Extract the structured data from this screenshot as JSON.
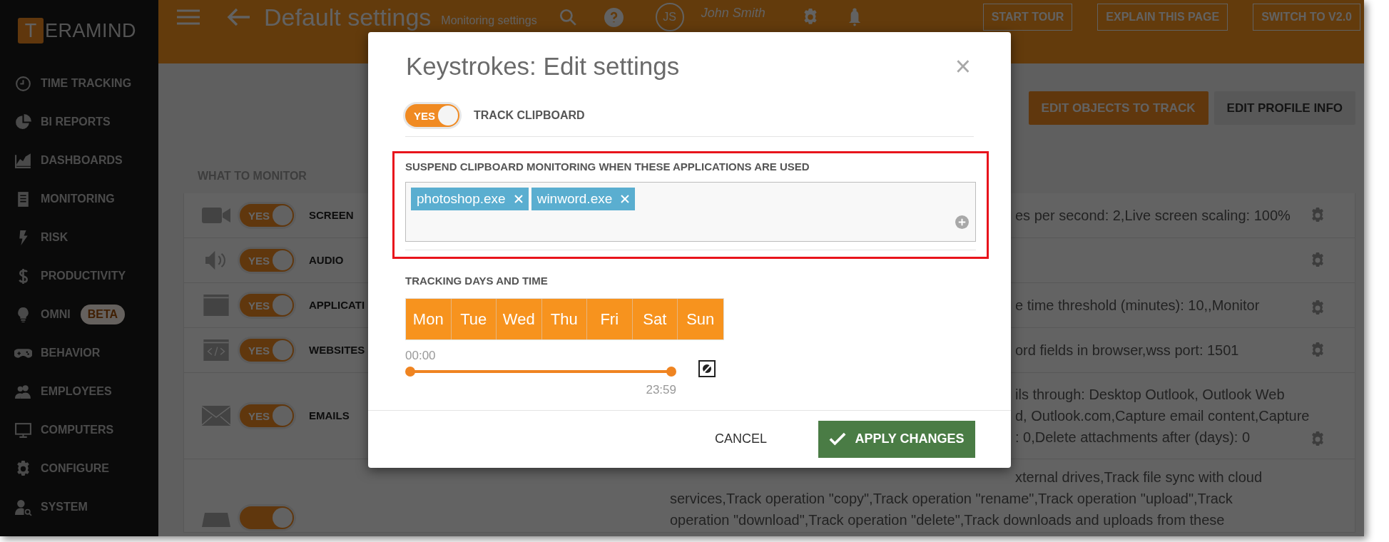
{
  "sidebar": {
    "logo": {
      "letter": "T",
      "text": "ERAMIND"
    },
    "items": [
      {
        "label": "TIME TRACKING"
      },
      {
        "label": "BI REPORTS"
      },
      {
        "label": "DASHBOARDS"
      },
      {
        "label": "MONITORING"
      },
      {
        "label": "RISK"
      },
      {
        "label": "PRODUCTIVITY"
      },
      {
        "label": "OMNI",
        "badge": "BETA"
      },
      {
        "label": "BEHAVIOR"
      },
      {
        "label": "EMPLOYEES"
      },
      {
        "label": "COMPUTERS"
      },
      {
        "label": "CONFIGURE"
      },
      {
        "label": "SYSTEM"
      }
    ]
  },
  "header": {
    "title": "Default settings",
    "subtitle": "Monitoring settings",
    "user": {
      "initials": "JS",
      "name": "John Smith"
    },
    "buttons": [
      "START TOUR",
      "EXPLAIN THIS PAGE",
      "SWITCH TO V2.0"
    ]
  },
  "toolbar": {
    "buttons": [
      {
        "label": "EDIT OBJECTS TO TRACK",
        "kind": "primary"
      },
      {
        "label": "EDIT PROFILE INFO",
        "kind": "secondary"
      }
    ]
  },
  "monitor": {
    "heading": "WHAT TO MONITOR",
    "rows": [
      {
        "toggle": {
          "on": true,
          "text": "YES"
        },
        "label": "SCREEN",
        "settings": true,
        "details": [
          {
            "text": "es per second: 2,Live screen scaling: 100%",
            "behind_dialog": true
          }
        ]
      },
      {
        "toggle": {
          "on": true,
          "text": "YES"
        },
        "label": "AUDIO",
        "settings": true,
        "details": []
      },
      {
        "toggle": {
          "on": true,
          "text": "YES"
        },
        "label": "APPLICATI",
        "settings": true,
        "details": [
          {
            "text": "e time threshold (minutes): 10,,Monitor",
            "behind_dialog": true
          }
        ]
      },
      {
        "toggle": {
          "on": true,
          "text": "YES"
        },
        "label": "WEBSITES",
        "settings": true,
        "details": [
          {
            "text": "ord fields in browser,wss port: 1501",
            "behind_dialog": true
          }
        ]
      },
      {
        "toggle": {
          "on": true,
          "text": "YES"
        },
        "label": "EMAILS",
        "settings": true,
        "details": [
          {
            "text": "ils through: Desktop Outlook, Outlook Web",
            "behind_dialog": true
          },
          {
            "text": "d, Outlook.com,Capture email content,Capture",
            "behind_dialog": true
          },
          {
            "text": ": 0,Delete attachments after (days): 0",
            "behind_dialog": true
          }
        ]
      },
      {
        "toggle": {
          "on": true
        },
        "settings": false,
        "details": [
          {
            "text": "xternal drives,Track file sync with cloud",
            "behind_dialog": true
          },
          {
            "text": "services,Track operation \"copy\",Track operation \"rename\",Track operation \"upload\",Track",
            "behind_dialog": false
          },
          {
            "text": "operation \"download\",Track operation \"delete\",Track downloads and uploads from these",
            "behind_dialog": false
          }
        ]
      }
    ]
  },
  "modal": {
    "title": "Keystrokes: Edit settings",
    "close": "×",
    "track_clipboard": {
      "on": true,
      "text": "YES",
      "label": "TRACK CLIPBOARD"
    },
    "suspend": {
      "label": "SUSPEND CLIPBOARD MONITORING WHEN THESE APPLICATIONS ARE USED",
      "tags": [
        "photoshop.exe",
        "winword.exe"
      ]
    },
    "schedule": {
      "label": "TRACKING DAYS AND TIME",
      "days": [
        {
          "label": "Mon",
          "selected": true
        },
        {
          "label": "Tue",
          "selected": true
        },
        {
          "label": "Wed",
          "selected": true
        },
        {
          "label": "Thu",
          "selected": true
        },
        {
          "label": "Fri",
          "selected": true
        },
        {
          "label": "Sat",
          "selected": true
        },
        {
          "label": "Sun",
          "selected": true
        }
      ],
      "start": "00:00",
      "end": "23:59",
      "level": 1
    },
    "buttons": {
      "cancel": "CANCEL",
      "apply": "APPLY CHANGES"
    }
  }
}
